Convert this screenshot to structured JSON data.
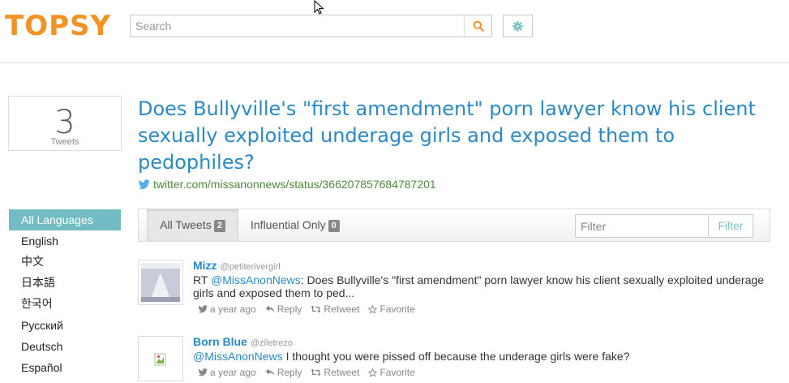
{
  "header": {
    "logo_text": "TOPSY",
    "logo_color": "#f39323",
    "search_placeholder": "Search",
    "search_icon": "search-icon",
    "settings_icon": "gear-icon"
  },
  "summary": {
    "count": "3",
    "count_label": "Tweets"
  },
  "article": {
    "title": "Does Bullyville's \"first amendment\" porn lawyer know his client sexually exploited underage girls and exposed them to pedophiles?",
    "source_url": "twitter.com/missanonnews/status/366207857684787201"
  },
  "languages": [
    {
      "label": "All Languages",
      "active": true
    },
    {
      "label": "English"
    },
    {
      "label": "中文"
    },
    {
      "label": "日本語"
    },
    {
      "label": "한국어"
    },
    {
      "label": "Русский"
    },
    {
      "label": "Deutsch"
    },
    {
      "label": "Español"
    }
  ],
  "tabs": {
    "all_label": "All Tweets",
    "all_count": "2",
    "influential_label": "Influential Only",
    "influential_count": "0",
    "filter_placeholder": "Filter",
    "filter_button": "Filter"
  },
  "tweets": [
    {
      "name": "Mizz",
      "handle": "@petiterivergirl",
      "prefix": "RT ",
      "mention": "@MissAnonNews",
      "text": ": Does Bullyville's \"first amendment\" porn lawyer know his client sexually exploited underage girls and exposed them to ped...",
      "time": "a year ago",
      "reply": "Reply",
      "retweet": "Retweet",
      "favorite": "Favorite"
    },
    {
      "name": "Born Blue",
      "handle": "@ziletrezo",
      "prefix": "",
      "mention": "@MissAnonNews",
      "text": " I thought you were pissed off because the underage girls were fake?",
      "time": "a year ago",
      "reply": "Reply",
      "retweet": "Retweet",
      "favorite": "Favorite"
    }
  ],
  "colors": {
    "accent_blue": "#2b8ac6",
    "active_language_bg": "#72bdc5",
    "link_green": "#4d8a3d"
  }
}
